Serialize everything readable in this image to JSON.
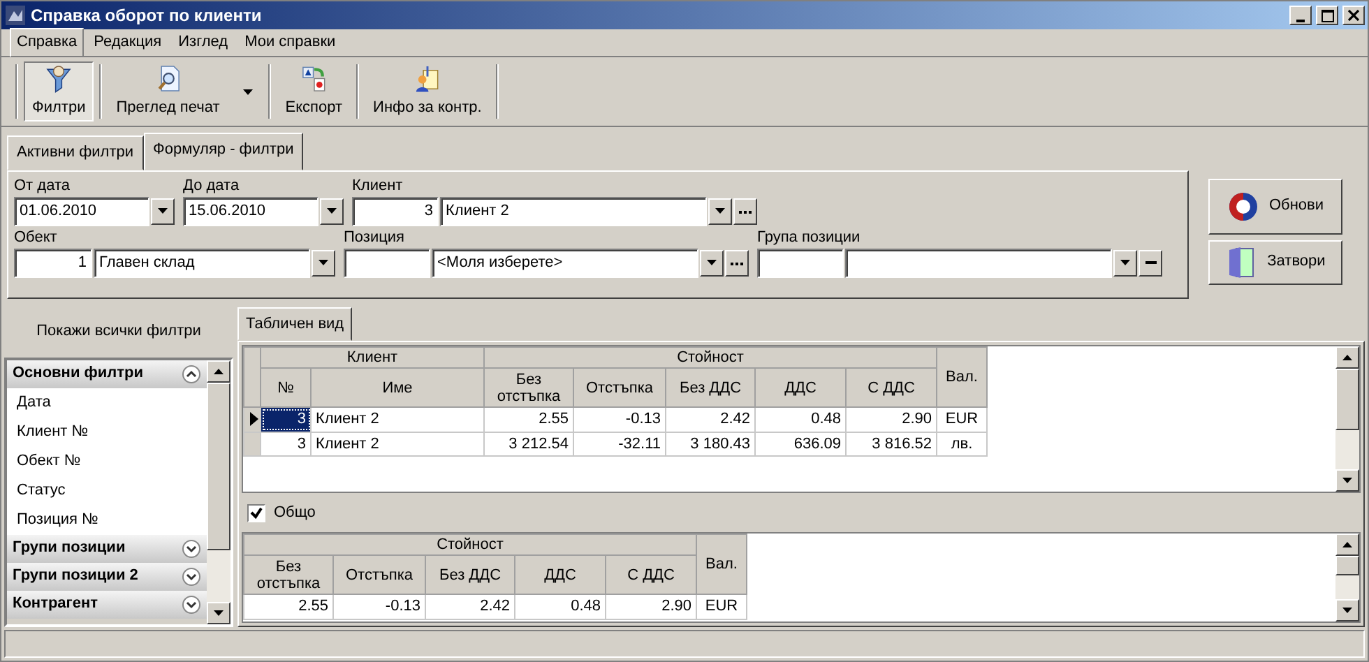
{
  "window": {
    "title": "Справка оборот по клиенти"
  },
  "menu": [
    {
      "label": "Справка",
      "selected": true
    },
    {
      "label": "Редакция",
      "selected": false
    },
    {
      "label": "Изглед",
      "selected": false
    },
    {
      "label": "Мои справки",
      "selected": false
    }
  ],
  "toolbar": [
    {
      "label": "Филтри",
      "kind": "filter",
      "pressed": true,
      "dropdown": false
    },
    {
      "label": "Преглед печат",
      "kind": "preview",
      "pressed": false,
      "dropdown": true
    },
    {
      "label": "Експорт",
      "kind": "export",
      "pressed": false,
      "dropdown": false
    },
    {
      "label": "Инфо за контр.",
      "kind": "info",
      "pressed": false,
      "dropdown": false
    }
  ],
  "filter_tabs": [
    {
      "label": "Активни филтри",
      "selected": false
    },
    {
      "label": "Формуляр - филтри",
      "selected": true
    }
  ],
  "filter_rows": [
    [
      {
        "label": "От дата",
        "kind": "date",
        "value": "01.06.2010"
      },
      {
        "label": "До дата",
        "kind": "date",
        "value": "15.06.2010"
      },
      {
        "label": "Клиент",
        "kind": "lookup",
        "code": "3",
        "name": "Клиент 2",
        "browse": true
      }
    ],
    [
      {
        "label": "Обект",
        "kind": "lookup",
        "code": "1",
        "name": "Главен склад"
      },
      {
        "label": "Позиция",
        "kind": "lookup",
        "placeholder": "<Моля изберете>",
        "browse": true
      },
      {
        "label": "Група позиции",
        "kind": "lookup",
        "clear": true
      }
    ]
  ],
  "action_buttons": [
    {
      "label": "Обнови",
      "kind": "refresh"
    },
    {
      "label": "Затвори",
      "kind": "close"
    }
  ],
  "sidebar": {
    "show_all": "Покажи всички филтри",
    "groups": [
      {
        "title": "Основни филтри",
        "expanded": true,
        "items": [
          "Дата",
          "Клиент №",
          "Обект №",
          "Статус",
          "Позиция №"
        ]
      },
      {
        "title": "Групи позиции",
        "expanded": false
      },
      {
        "title": "Групи позиции 2",
        "expanded": false
      },
      {
        "title": "Контрагент",
        "expanded": false
      }
    ]
  },
  "view_tab": {
    "label": "Табличен вид",
    "selected": true
  },
  "table": {
    "header_groups": [
      {
        "label": "Клиент",
        "columns": [
          "№",
          "Име"
        ]
      },
      {
        "label": "Стойност",
        "columns": [
          "Без отстъпка",
          "Отстъпка",
          "Без ДДС",
          "ДДС",
          "С ДДС"
        ]
      },
      {
        "label": "Вал."
      }
    ],
    "rows": [
      {
        "current": true,
        "cells": [
          "3",
          "Клиент 2",
          "2.55",
          "-0.13",
          "2.42",
          "0.48",
          "2.90",
          "EUR"
        ]
      },
      {
        "current": false,
        "cells": [
          "3",
          "Клиент 2",
          "3 212.54",
          "-32.11",
          "3 180.43",
          "636.09",
          "3 816.52",
          "лв."
        ]
      }
    ]
  },
  "totals": {
    "label": "Общо",
    "checked": true,
    "table": {
      "header_groups": [
        {
          "label": "Стойност",
          "columns": [
            "Без отстъпка",
            "Отстъпка",
            "Без ДДС",
            "ДДС",
            "С ДДС"
          ]
        },
        {
          "label": "Вал."
        }
      ],
      "rows": [
        {
          "cells": [
            "2.55",
            "-0.13",
            "2.42",
            "0.48",
            "2.90",
            "EUR"
          ]
        }
      ]
    }
  }
}
